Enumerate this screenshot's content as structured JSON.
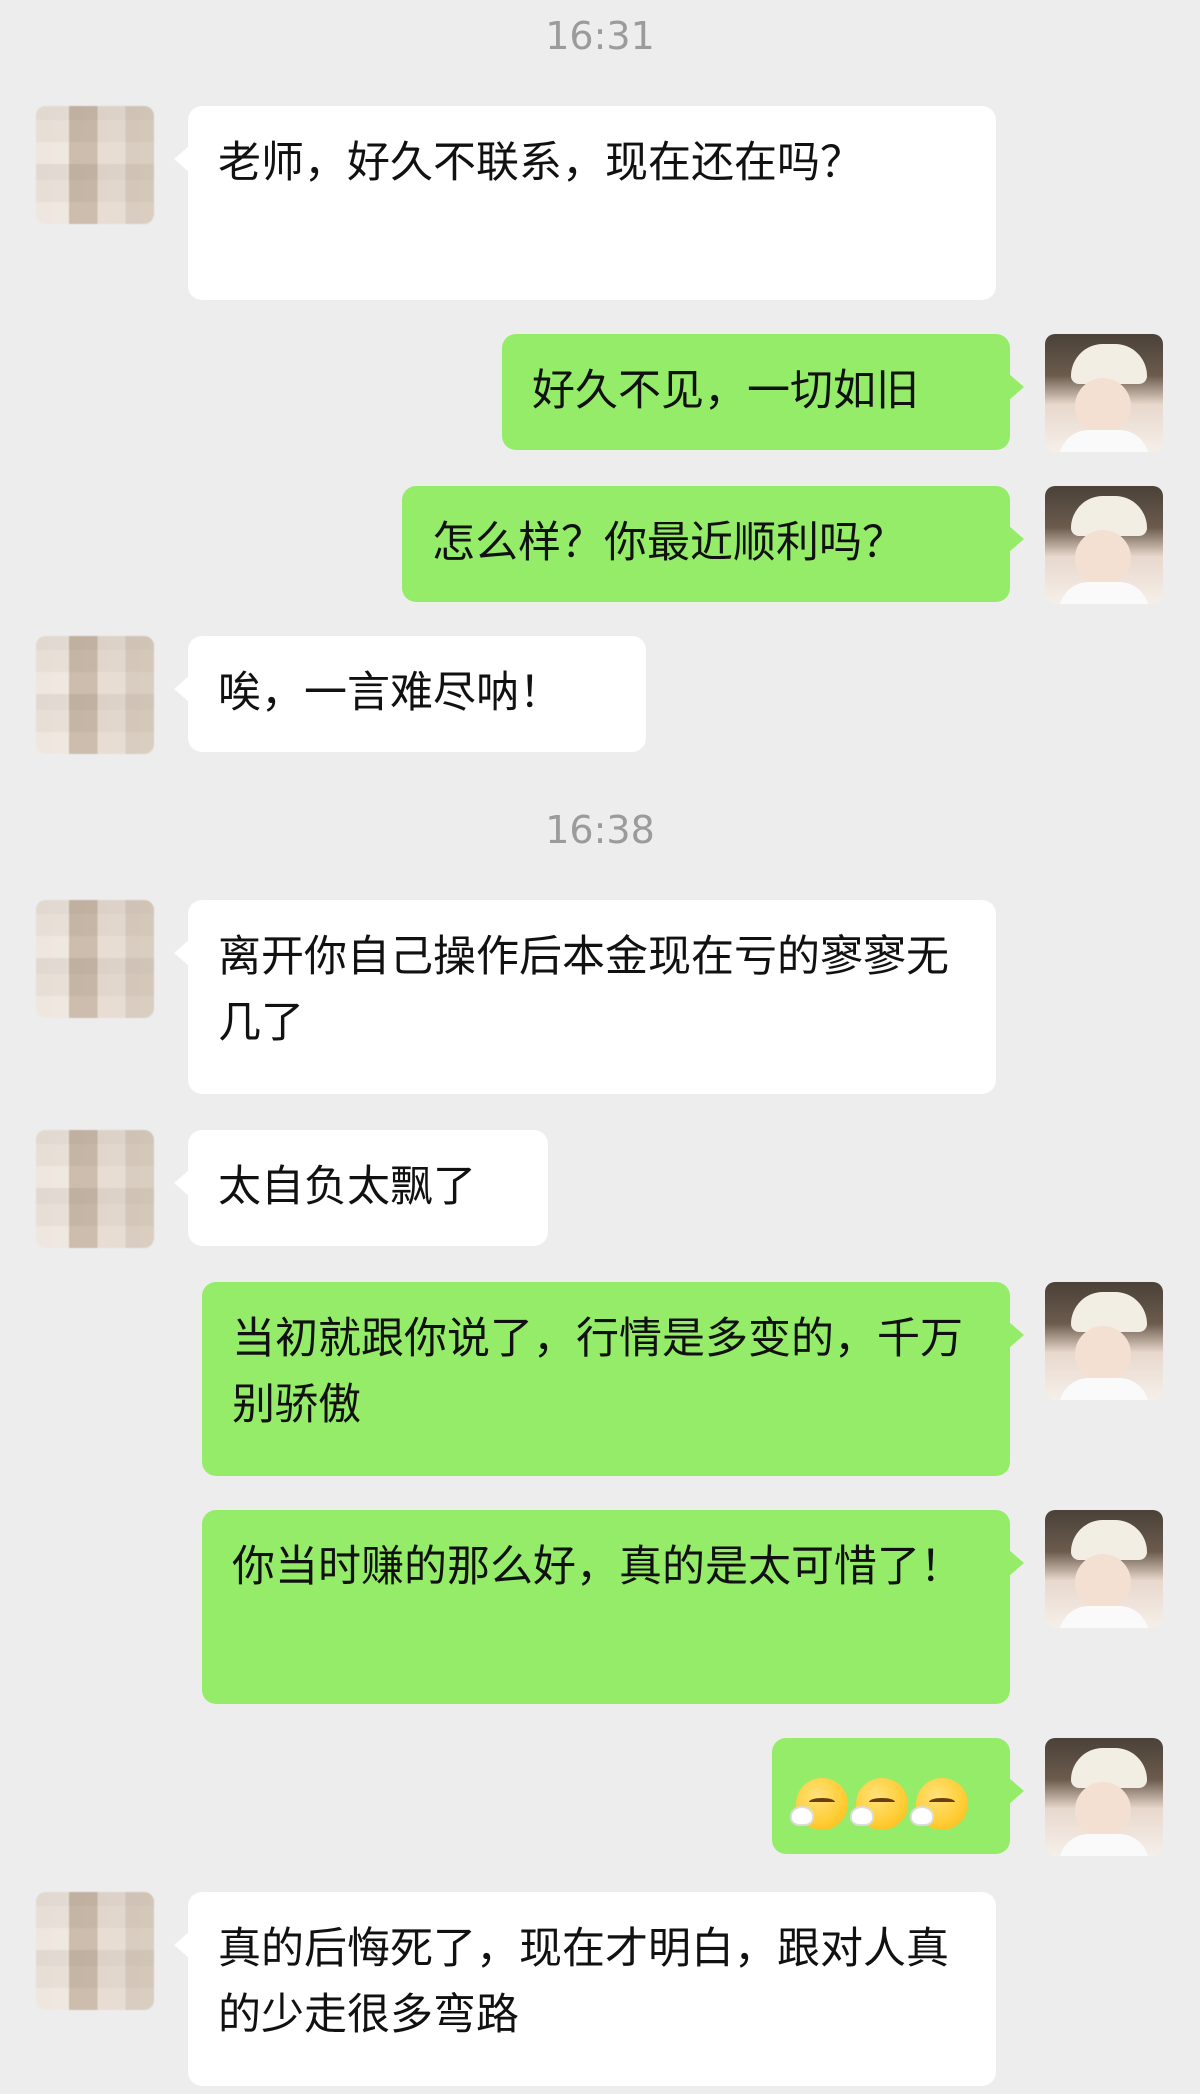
{
  "chat": {
    "timestamps": [
      "16:31",
      "16:38"
    ],
    "messages": [
      {
        "side": "peer",
        "text": "老师，好久不联系，现在还在吗？"
      },
      {
        "side": "self",
        "text": "好久不见，一切如旧"
      },
      {
        "side": "self",
        "text": "怎么样？你最近顺利吗？"
      },
      {
        "side": "peer",
        "text": "唉，一言难尽呐！"
      },
      {
        "side": "peer",
        "text": "离开你自己操作后本金现在亏的寥寥无几了"
      },
      {
        "side": "peer",
        "text": "太自负太飘了"
      },
      {
        "side": "self",
        "text": "当初就跟你说了，行情是多变的，千万别骄傲"
      },
      {
        "side": "self",
        "text": "你当时赚的那么好，真的是太可惜了！"
      },
      {
        "side": "self",
        "emoji": [
          "sighing-face-emoji",
          "sighing-face-emoji",
          "sighing-face-emoji"
        ]
      },
      {
        "side": "peer",
        "text": "真的后悔死了，现在才明白，跟对人真的少走很多弯路"
      }
    ]
  },
  "colors": {
    "background": "#ededed",
    "self_bubble": "#95ec69",
    "peer_bubble": "#ffffff",
    "timestamp": "#9b9b9b"
  }
}
